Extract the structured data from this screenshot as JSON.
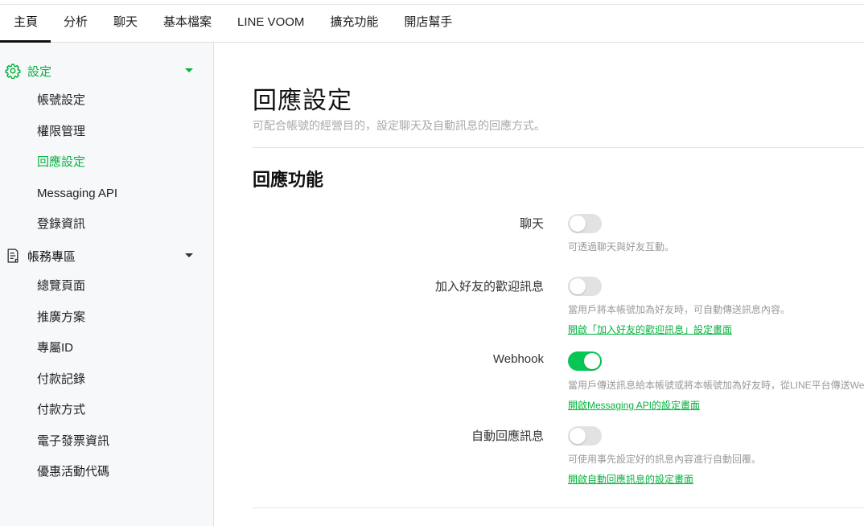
{
  "tabs": [
    {
      "label": "主頁"
    },
    {
      "label": "分析"
    },
    {
      "label": "聊天"
    },
    {
      "label": "基本檔案"
    },
    {
      "label": "LINE VOOM"
    },
    {
      "label": "擴充功能"
    },
    {
      "label": "開店幫手"
    }
  ],
  "active_tab": "主頁",
  "sidebar": {
    "settings": {
      "label": "設定",
      "icon": "gear-icon",
      "items": [
        "帳號設定",
        "權限管理",
        "回應設定",
        "Messaging API",
        "登錄資訊"
      ],
      "active": "回應設定"
    },
    "billing": {
      "label": "帳務專區",
      "icon": "receipt-icon",
      "items": [
        "總覽頁面",
        "推廣方案",
        "專屬ID",
        "付款記錄",
        "付款方式",
        "電子發票資訊",
        "優惠活動代碼"
      ]
    }
  },
  "main": {
    "title": "回應設定",
    "description": "可配合帳號的經營目的，設定聊天及自動訊息的回應方式。",
    "section_title": "回應功能",
    "settings": [
      {
        "label": "聊天",
        "enabled": false,
        "help": "可透過聊天與好友互動。",
        "link": ""
      },
      {
        "label": "加入好友的歡迎訊息",
        "enabled": false,
        "help": "當用戶將本帳號加為好友時，可自動傳送訊息內容。",
        "link": "開啟「加入好友的歡迎訊息」設定畫面"
      },
      {
        "label": "Webhook",
        "enabled": true,
        "help": "當用戶傳送訊息給本帳號或將本帳號加為好友時，從LINE平台傳送Webhook",
        "link": "開啟Messaging API的設定畫面"
      },
      {
        "label": "自動回應訊息",
        "enabled": false,
        "help": "可使用事先設定好的訊息內容進行自動回覆。",
        "link": "開啟自動回應訊息的設定畫面"
      }
    ]
  },
  "colors": {
    "accent": "#06b23f",
    "toggle_on": "#06c755",
    "toggle_off": "#e2e2e4",
    "sidebar_bg": "#f7f8fa"
  }
}
